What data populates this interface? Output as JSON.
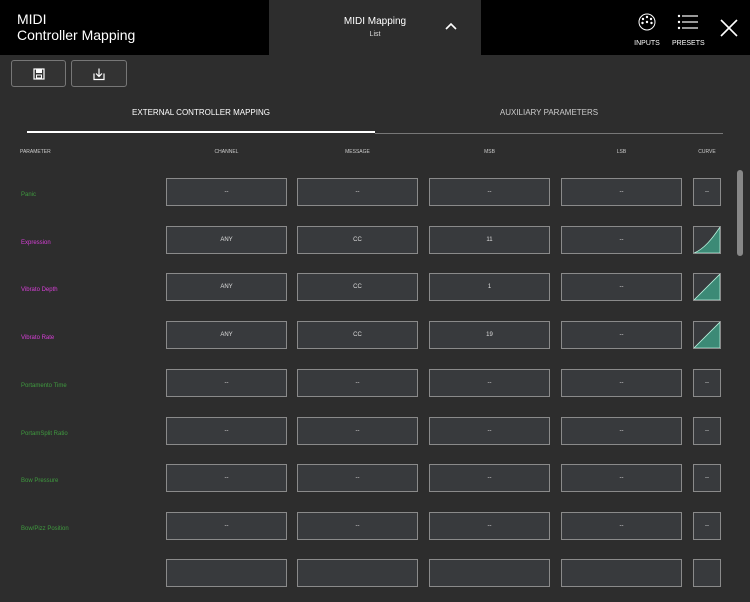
{
  "header": {
    "app_title_line1": "MIDI",
    "app_title_line2": "Controller Mapping",
    "center_title": "MIDI Mapping",
    "center_subtitle": "List",
    "inputs_label": "INPUTS",
    "presets_label": "PRESETS"
  },
  "tabs": {
    "external": "EXTERNAL CONTROLLER MAPPING",
    "auxiliary": "AUXILIARY PARAMETERS"
  },
  "columns": {
    "parameter": "PARAMETER",
    "channel": "CHANNEL",
    "message": "MESSAGE",
    "msb": "MSB",
    "lsb": "LSB",
    "curve": "CURVE"
  },
  "rows": [
    {
      "name": "Panic",
      "channel": "--",
      "message": "--",
      "msb": "--",
      "lsb": "--",
      "curve": "--"
    },
    {
      "name": "Expression",
      "channel": "ANY",
      "message": "CC",
      "msb": "11",
      "lsb": "--",
      "curve": ""
    },
    {
      "name": "Vibrato Depth",
      "channel": "ANY",
      "message": "CC",
      "msb": "1",
      "lsb": "--",
      "curve": ""
    },
    {
      "name": "Vibrato Rate",
      "channel": "ANY",
      "message": "CC",
      "msb": "19",
      "lsb": "--",
      "curve": ""
    },
    {
      "name": "Portamento Time",
      "channel": "--",
      "message": "--",
      "msb": "--",
      "lsb": "--",
      "curve": "--"
    },
    {
      "name": "PortamSplit Ratio",
      "channel": "--",
      "message": "--",
      "msb": "--",
      "lsb": "--",
      "curve": "--"
    },
    {
      "name": "Bow Pressure",
      "channel": "--",
      "message": "--",
      "msb": "--",
      "lsb": "--",
      "curve": "--"
    },
    {
      "name": "Bow/Pizz Position",
      "channel": "--",
      "message": "--",
      "msb": "--",
      "lsb": "--",
      "curve": "--"
    }
  ],
  "colors": {
    "green": "#3f9a3f",
    "magenta": "#d63fd6",
    "curve_fill": "#3c8a76"
  }
}
